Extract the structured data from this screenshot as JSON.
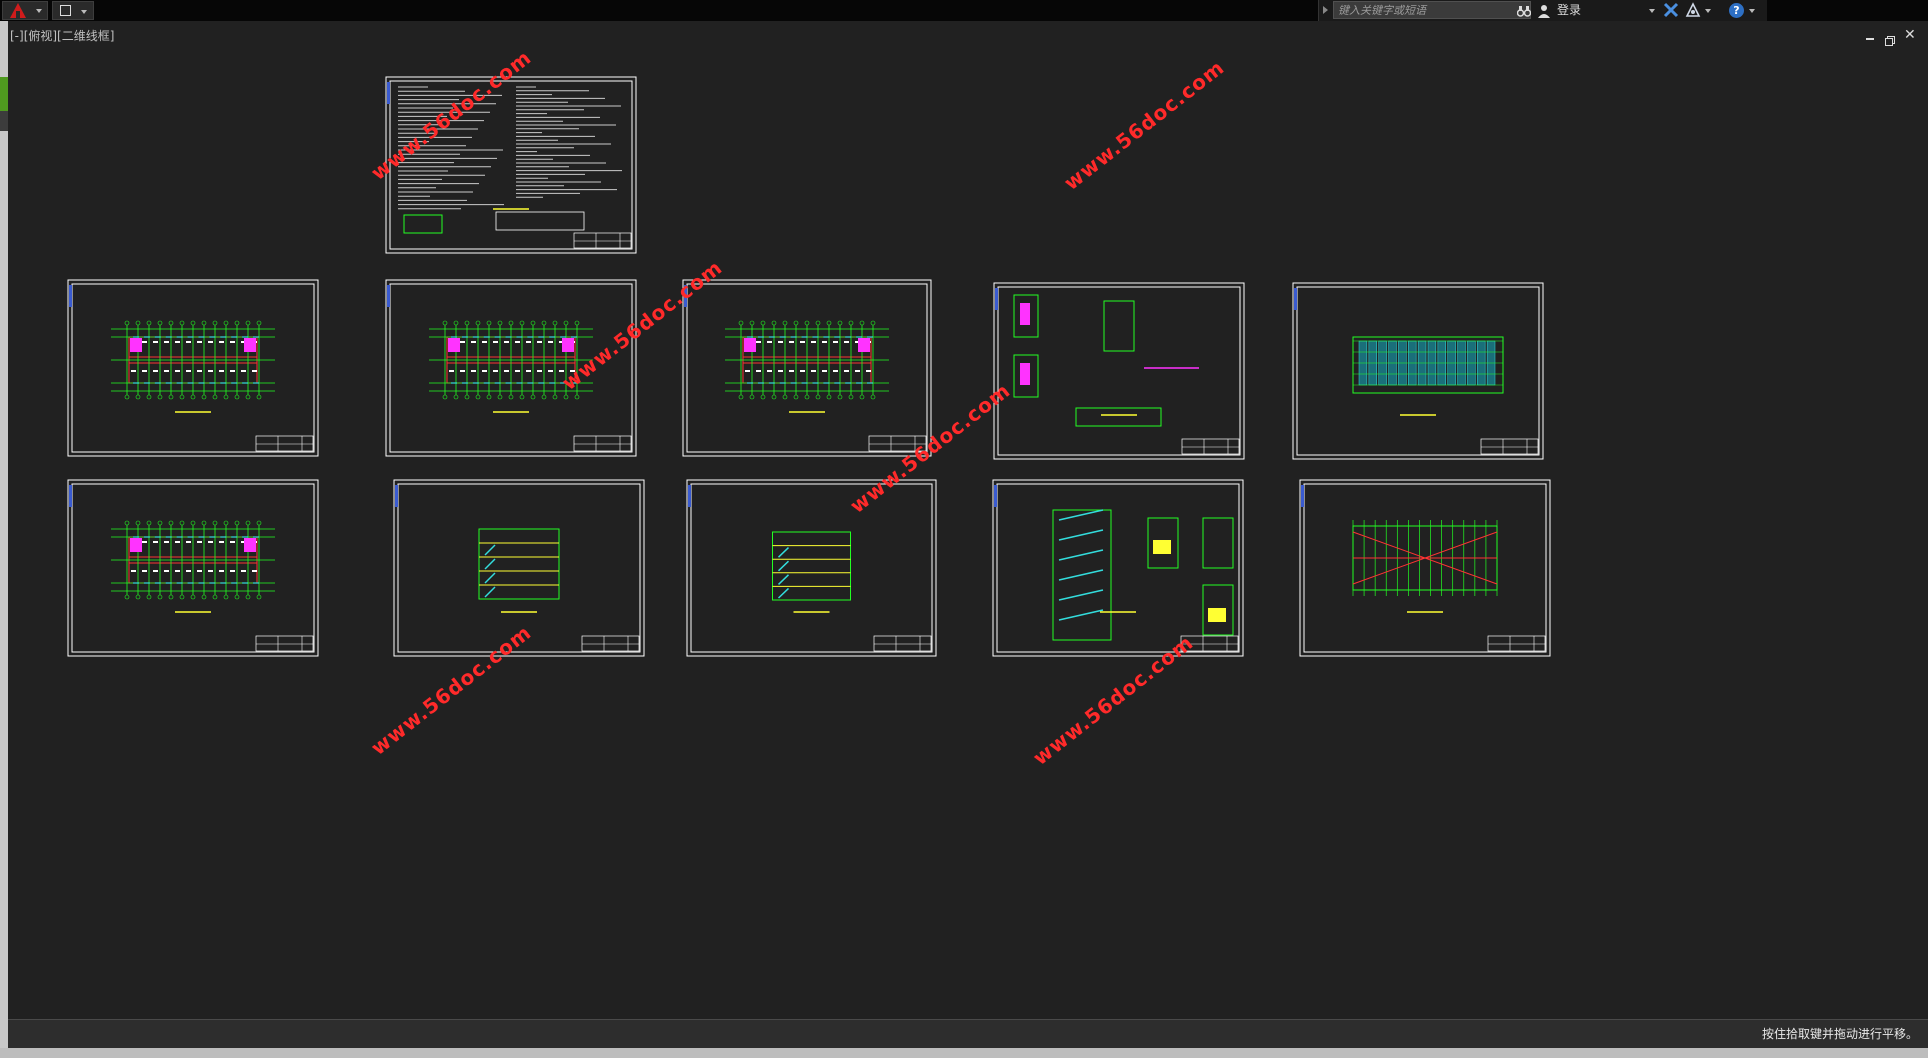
{
  "app": {
    "quick_access_label": ""
  },
  "search": {
    "placeholder": "键入关键字或短语"
  },
  "user": {
    "login_label": "登录"
  },
  "viewport": {
    "label": "[-][俯视][二维线框]"
  },
  "status": {
    "message": "按住拾取键并拖动进行平移。"
  },
  "watermark": {
    "text": "www.56doc.com"
  },
  "colors": {
    "background": "#212121",
    "frame": "#ffffff",
    "grid": "#22ff22",
    "walls": "#ff3333",
    "accent_magenta": "#ff33ff",
    "accent_cyan": "#33dddd",
    "accent_yellow": "#ffff33",
    "watermark": "#ff2a2a"
  },
  "sheets": [
    {
      "id": "design-notes",
      "content": "notes"
    },
    {
      "id": "floor-plan-1",
      "content": "plan"
    },
    {
      "id": "floor-plan-2",
      "content": "plan"
    },
    {
      "id": "floor-plan-3",
      "content": "plan"
    },
    {
      "id": "details",
      "content": "details"
    },
    {
      "id": "elevation-front",
      "content": "elevation"
    },
    {
      "id": "floor-plan-4",
      "content": "plan"
    },
    {
      "id": "section-1-1",
      "content": "section"
    },
    {
      "id": "elevation-side",
      "content": "side"
    },
    {
      "id": "stair-details",
      "content": "stairs"
    },
    {
      "id": "roof-plan",
      "content": "roof"
    }
  ]
}
